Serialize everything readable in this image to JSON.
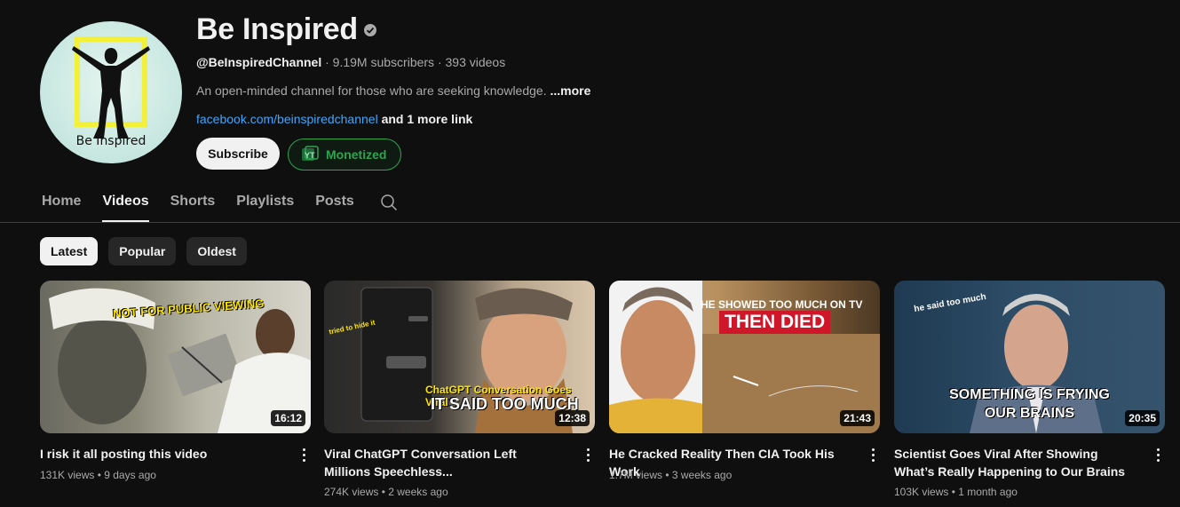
{
  "channel": {
    "name": "Be Inspired",
    "avatar_text": "Be Inspired",
    "handle": "@BeInspiredChannel",
    "stats": "· 9.19M subscribers · 393 videos",
    "description": "An open-minded channel for those who are seeking knowledge.",
    "more_label": "...more",
    "link": "facebook.com/beinspiredchannel",
    "extra_links": "and 1 more link",
    "subscribe_label": "Subscribe",
    "monetized_label": "Monetized"
  },
  "tabs": [
    {
      "label": "Home",
      "active": false
    },
    {
      "label": "Videos",
      "active": true
    },
    {
      "label": "Shorts",
      "active": false
    },
    {
      "label": "Playlists",
      "active": false
    },
    {
      "label": "Posts",
      "active": false
    }
  ],
  "chips": [
    {
      "label": "Latest",
      "active": true
    },
    {
      "label": "Popular",
      "active": false
    },
    {
      "label": "Oldest",
      "active": false
    }
  ],
  "videos": [
    {
      "title": "I risk it all posting this video",
      "meta": "131K views • 9 days ago",
      "duration": "16:12",
      "thumb_text": [
        "NOT FOR PUBLIC VIEWING"
      ]
    },
    {
      "title": "Viral ChatGPT Conversation Left Millions Speechless...",
      "meta": "274K views • 2 weeks ago",
      "duration": "12:38",
      "thumb_text": [
        "ChatGPT Conversation Goes Viral",
        "IT SAID TOO MUCH",
        "tried to hide it"
      ]
    },
    {
      "title": "He Cracked Reality Then CIA Took His Work",
      "meta": "1.7M views • 3 weeks ago",
      "duration": "21:43",
      "thumb_text": [
        "HE SHOWED TOO MUCH ON TV",
        "THEN DIED"
      ]
    },
    {
      "title": "Scientist Goes Viral After Showing What’s Really Happening to Our Brains",
      "meta": "103K views • 1 month ago",
      "duration": "20:35",
      "thumb_text": [
        "he said too much",
        "SOMETHING IS FRYING OUR BRAINS"
      ]
    }
  ],
  "colors": {
    "background": "#0f0f0f",
    "link": "#3ea6ff",
    "monetized": "#2ea44f",
    "subtext": "#aaaaaa"
  }
}
